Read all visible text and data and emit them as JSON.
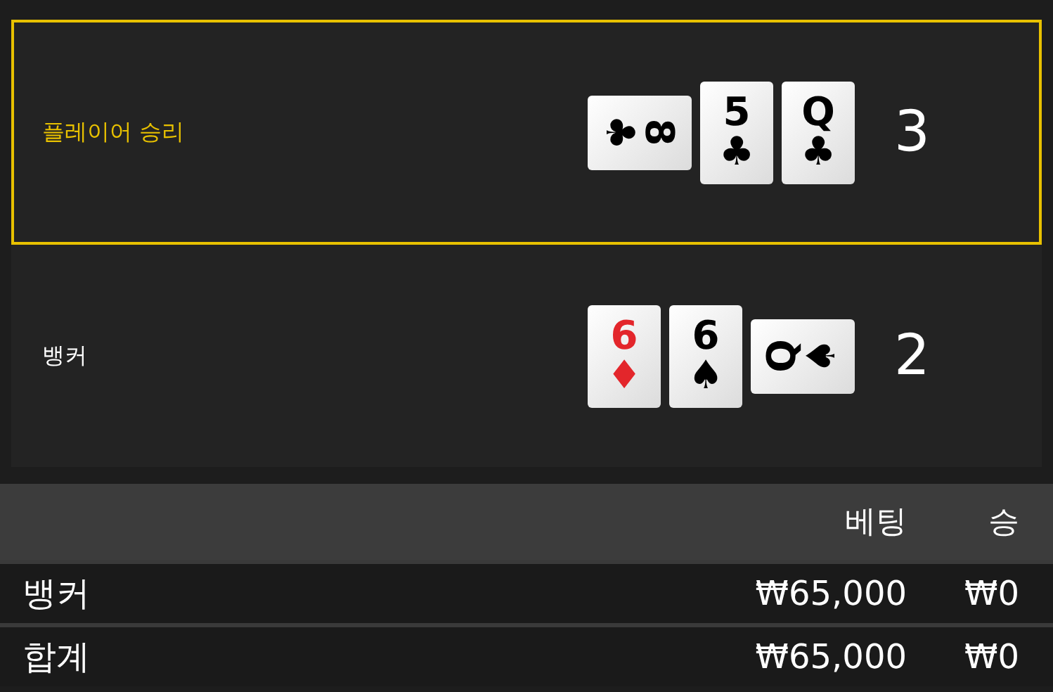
{
  "hands": [
    {
      "label": "플레이어 승리",
      "selected": true,
      "score": "3",
      "cards": [
        {
          "rank": "8",
          "suit": "♣",
          "color": "#000000",
          "kind": "turned-right"
        },
        {
          "rank": "5",
          "suit": "♣",
          "color": "#000000",
          "kind": "upright"
        },
        {
          "rank": "Q",
          "suit": "♣",
          "color": "#000000",
          "kind": "upright"
        }
      ]
    },
    {
      "label": "뱅커",
      "selected": false,
      "score": "2",
      "cards": [
        {
          "rank": "6",
          "suit": "♦",
          "color": "#e3262b",
          "kind": "upright"
        },
        {
          "rank": "6",
          "suit": "♠",
          "color": "#000000",
          "kind": "upright"
        },
        {
          "rank": "Q",
          "suit": "♠",
          "color": "#000000",
          "kind": "turned-left"
        }
      ]
    }
  ],
  "table": {
    "columns": [
      "베팅",
      "승"
    ],
    "rows": [
      {
        "label": "뱅커",
        "bet": "₩65,000",
        "win": "₩0"
      },
      {
        "label": "합계",
        "bet": "₩65,000",
        "win": "₩0"
      }
    ]
  }
}
